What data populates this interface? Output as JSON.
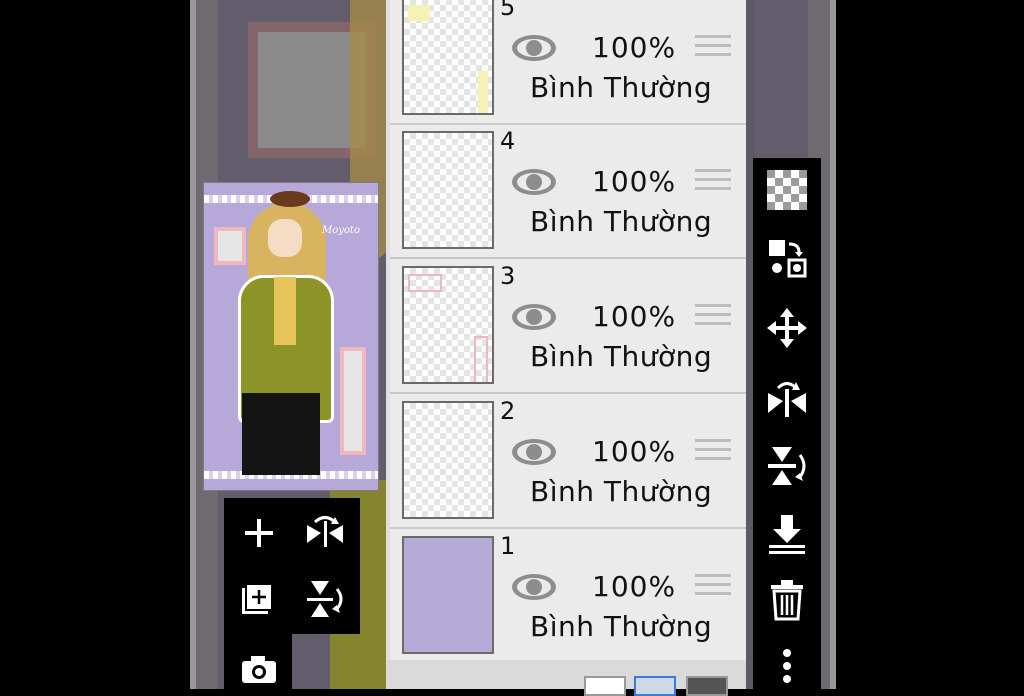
{
  "layers": [
    {
      "number": "5",
      "opacity": "100%",
      "blend_mode": "Bình Thường"
    },
    {
      "number": "4",
      "opacity": "100%",
      "blend_mode": "Bình Thường"
    },
    {
      "number": "3",
      "opacity": "100%",
      "blend_mode": "Bình Thường"
    },
    {
      "number": "2",
      "opacity": "100%",
      "blend_mode": "Bình Thường"
    },
    {
      "number": "1",
      "opacity": "100%",
      "blend_mode": "Bình Thường"
    }
  ],
  "preview": {
    "signature": "Moyoto"
  },
  "left_tools": [
    "add-layer-icon",
    "flip-horizontal-icon",
    "add-layer-copy-icon",
    "flip-vertical-icon",
    "camera-icon"
  ],
  "right_tools": [
    "transparency-icon",
    "swap-layer-icon",
    "move-icon",
    "flip-horizontal-icon",
    "flip-vertical-icon",
    "merge-down-icon",
    "delete-icon",
    "more-icon"
  ],
  "colors": {
    "panel": "#ebebeb",
    "toolbar": "#000000",
    "layer1_fill": "#b6aad8",
    "canvas": "#625c6c"
  }
}
